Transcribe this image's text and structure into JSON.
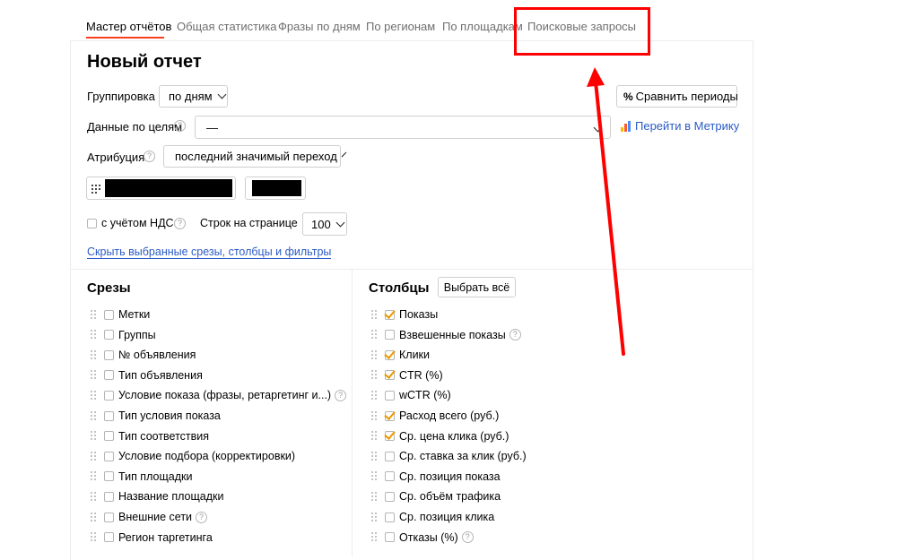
{
  "tabs": [
    {
      "label": "Мастер отчётов",
      "active": true
    },
    {
      "label": "Общая статистика"
    },
    {
      "label": "Фразы по дням"
    },
    {
      "label": "По регионам"
    },
    {
      "label": "По площадкам"
    },
    {
      "label": "Поисковые запросы"
    }
  ],
  "report": {
    "title": "Новый отчет",
    "grouping_label": "Группировка",
    "grouping_value": "по дням",
    "compare_button": "Сравнить периоды",
    "goals_label": "Данные по целям",
    "goals_value": "—",
    "metrika_link": "Перейти в Метрику",
    "attribution_label": "Атрибуция",
    "attribution_value": "последний значимый переход",
    "vat_label": "с учётом НДС",
    "rows_label": "Строк на странице",
    "rows_value": "100",
    "hide_link": "Скрыть выбранные срезы, столбцы и фильтры"
  },
  "slices": {
    "title": "Срезы",
    "items": [
      {
        "label": "Метки",
        "checked": false
      },
      {
        "label": "Группы",
        "checked": false
      },
      {
        "label": "№ объявления",
        "checked": false
      },
      {
        "label": "Тип объявления",
        "checked": false
      },
      {
        "label": "Условие показа (фразы, ретаргетинг и...)",
        "checked": false,
        "help": true
      },
      {
        "label": "Тип условия показа",
        "checked": false
      },
      {
        "label": "Тип соответствия",
        "checked": false
      },
      {
        "label": "Условие подбора (корректировки)",
        "checked": false
      },
      {
        "label": "Тип площадки",
        "checked": false
      },
      {
        "label": "Название площадки",
        "checked": false
      },
      {
        "label": "Внешние сети",
        "checked": false,
        "help": true
      },
      {
        "label": "Регион таргетинга",
        "checked": false
      }
    ]
  },
  "columns": {
    "title": "Столбцы",
    "select_all": "Выбрать всё",
    "items": [
      {
        "label": "Показы",
        "checked": true
      },
      {
        "label": "Взвешенные показы",
        "checked": false,
        "help": true
      },
      {
        "label": "Клики",
        "checked": true
      },
      {
        "label": "CTR (%)",
        "checked": true
      },
      {
        "label": "wCTR (%)",
        "checked": false
      },
      {
        "label": "Расход всего (руб.)",
        "checked": true
      },
      {
        "label": "Ср. цена клика (руб.)",
        "checked": true
      },
      {
        "label": "Ср. ставка за клик (руб.)",
        "checked": false
      },
      {
        "label": "Ср. позиция показа",
        "checked": false
      },
      {
        "label": "Ср. объём трафика",
        "checked": false
      },
      {
        "label": "Ср. позиция клика",
        "checked": false
      },
      {
        "label": "Отказы (%)",
        "checked": false,
        "help": true
      }
    ]
  },
  "help_glyph": "?",
  "colors": {
    "accent": "#fc3f1d",
    "link": "#2b5bc6",
    "annotation": "#ff0000",
    "check": "#e89a00"
  }
}
